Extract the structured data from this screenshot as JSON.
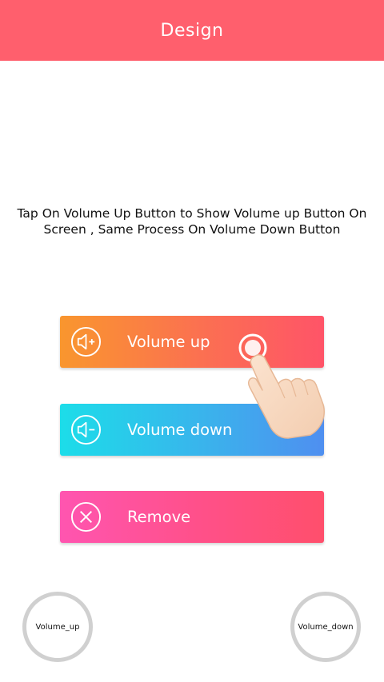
{
  "header": {
    "title": "Design",
    "bg_color": "#ff5f6d"
  },
  "instruction": {
    "line1": "Tap On Volume Up Button to Show Volume up Button On",
    "line2": "Screen , Same Process On Volume Down Button"
  },
  "buttons": [
    {
      "label": "Volume up",
      "icon": "speaker-plus-icon"
    },
    {
      "label": "Volume down",
      "icon": "speaker-minus-icon"
    },
    {
      "label": "Remove",
      "icon": "close-circle-icon"
    }
  ],
  "floating": {
    "left_label": "Volume_up",
    "right_label": "Volume_down"
  },
  "tutorial": {
    "icon": "tap-hand-icon"
  }
}
